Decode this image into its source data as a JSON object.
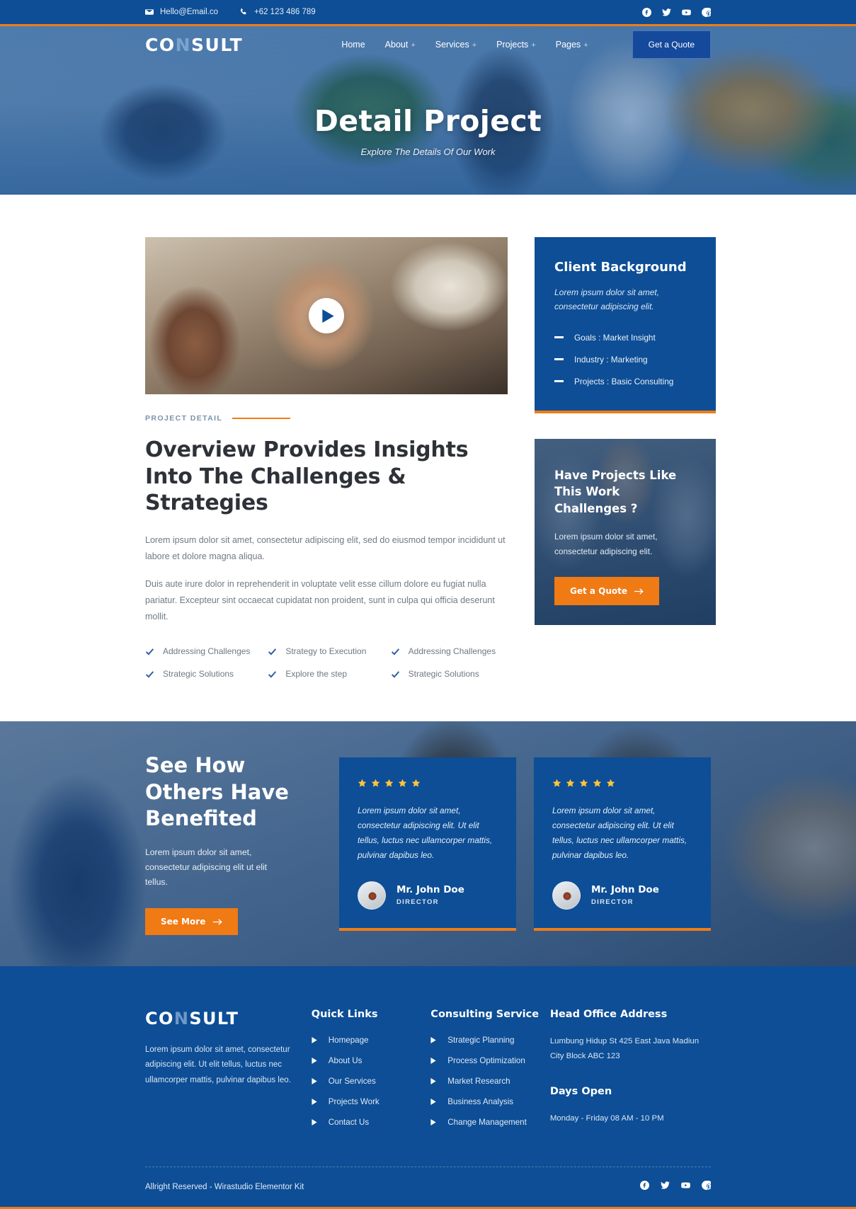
{
  "topbar": {
    "email": "Hello@Email.co",
    "phone": "+62 123 486 789",
    "socials": [
      "facebook-icon",
      "twitter-icon",
      "youtube-icon",
      "pinterest-icon"
    ]
  },
  "header": {
    "logo_pre": "CO",
    "logo_n": "N",
    "logo_post": "SULT",
    "nav": [
      {
        "label": "Home",
        "has_plus": false
      },
      {
        "label": "About",
        "has_plus": true
      },
      {
        "label": "Services",
        "has_plus": true
      },
      {
        "label": "Projects",
        "has_plus": true
      },
      {
        "label": "Pages",
        "has_plus": true
      }
    ],
    "quote_button": "Get a Quote"
  },
  "hero": {
    "title": "Detail Project",
    "subtitle": "Explore The Details Of Our Work"
  },
  "main": {
    "eyebrow": "PROJECT DETAIL",
    "heading": "Overview Provides Insights Into The Challenges & Strategies",
    "paragraph1": "Lorem ipsum dolor sit amet, consectetur adipiscing elit, sed do eiusmod tempor incididunt ut labore et dolore magna aliqua.",
    "paragraph2": "Duis aute irure dolor in reprehenderit in voluptate velit esse cillum dolore eu fugiat nulla pariatur. Excepteur sint occaecat cupidatat non proident, sunt in culpa qui officia deserunt mollit.",
    "checklist": [
      "Addressing Challenges",
      "Strategy to Execution",
      "Addressing Challenges",
      "Strategic Solutions",
      "Explore the step",
      "Strategic Solutions"
    ]
  },
  "client_background": {
    "title": "Client Background",
    "intro": "Lorem ipsum dolor sit amet, consectetur adipiscing elit.",
    "items": [
      "Goals : Market Insight",
      "Industry : Marketing",
      "Projects : Basic Consulting"
    ]
  },
  "cta_card": {
    "title": "Have Projects Like This Work Challenges ?",
    "text": "Lorem ipsum dolor sit amet, consectetur adipiscing elit.",
    "button": "Get a Quote"
  },
  "testimonial_band": {
    "heading": "See How Others Have Benefited",
    "text": "Lorem ipsum dolor sit amet, consectetur adipiscing elit ut elit tellus.",
    "button": "See More",
    "cards": [
      {
        "stars": 5,
        "quote": "Lorem ipsum dolor sit amet, consectetur adipiscing elit. Ut elit tellus, luctus nec ullamcorper mattis, pulvinar dapibus leo.",
        "name": "Mr. John Doe",
        "role": "DIRECTOR"
      },
      {
        "stars": 5,
        "quote": "Lorem ipsum dolor sit amet, consectetur adipiscing elit. Ut elit tellus, luctus nec ullamcorper mattis, pulvinar dapibus leo.",
        "name": "Mr. John Doe",
        "role": "DIRECTOR"
      }
    ]
  },
  "footer": {
    "logo_pre": "CO",
    "logo_n": "N",
    "logo_post": "SULT",
    "about": "Lorem ipsum dolor sit amet, consectetur adipiscing elit. Ut elit tellus, luctus nec ullamcorper mattis, pulvinar dapibus leo.",
    "quick_links_title": "Quick Links",
    "quick_links": [
      "Homepage",
      "About Us",
      "Our Services",
      "Projects Work",
      "Contact Us"
    ],
    "services_title": "Consulting Service",
    "services": [
      "Strategic Planning",
      "Process Optimization",
      "Market Research",
      "Business Analysis",
      "Change Management"
    ],
    "address_title": "Head Office Address",
    "address": "Lumbung Hidup St 425 East Java Madiun City Block ABC 123",
    "days_title": "Days Open",
    "days": "Monday - Friday 08 AM - 10 PM",
    "copyright": "Allright Reserved - Wirastudio Elementor Kit",
    "socials": [
      "facebook-icon",
      "twitter-icon",
      "youtube-icon",
      "pinterest-icon"
    ]
  },
  "colors": {
    "brand_blue": "#0d4e96",
    "accent_orange": "#ef7c16",
    "star_yellow": "#ffc43c"
  }
}
